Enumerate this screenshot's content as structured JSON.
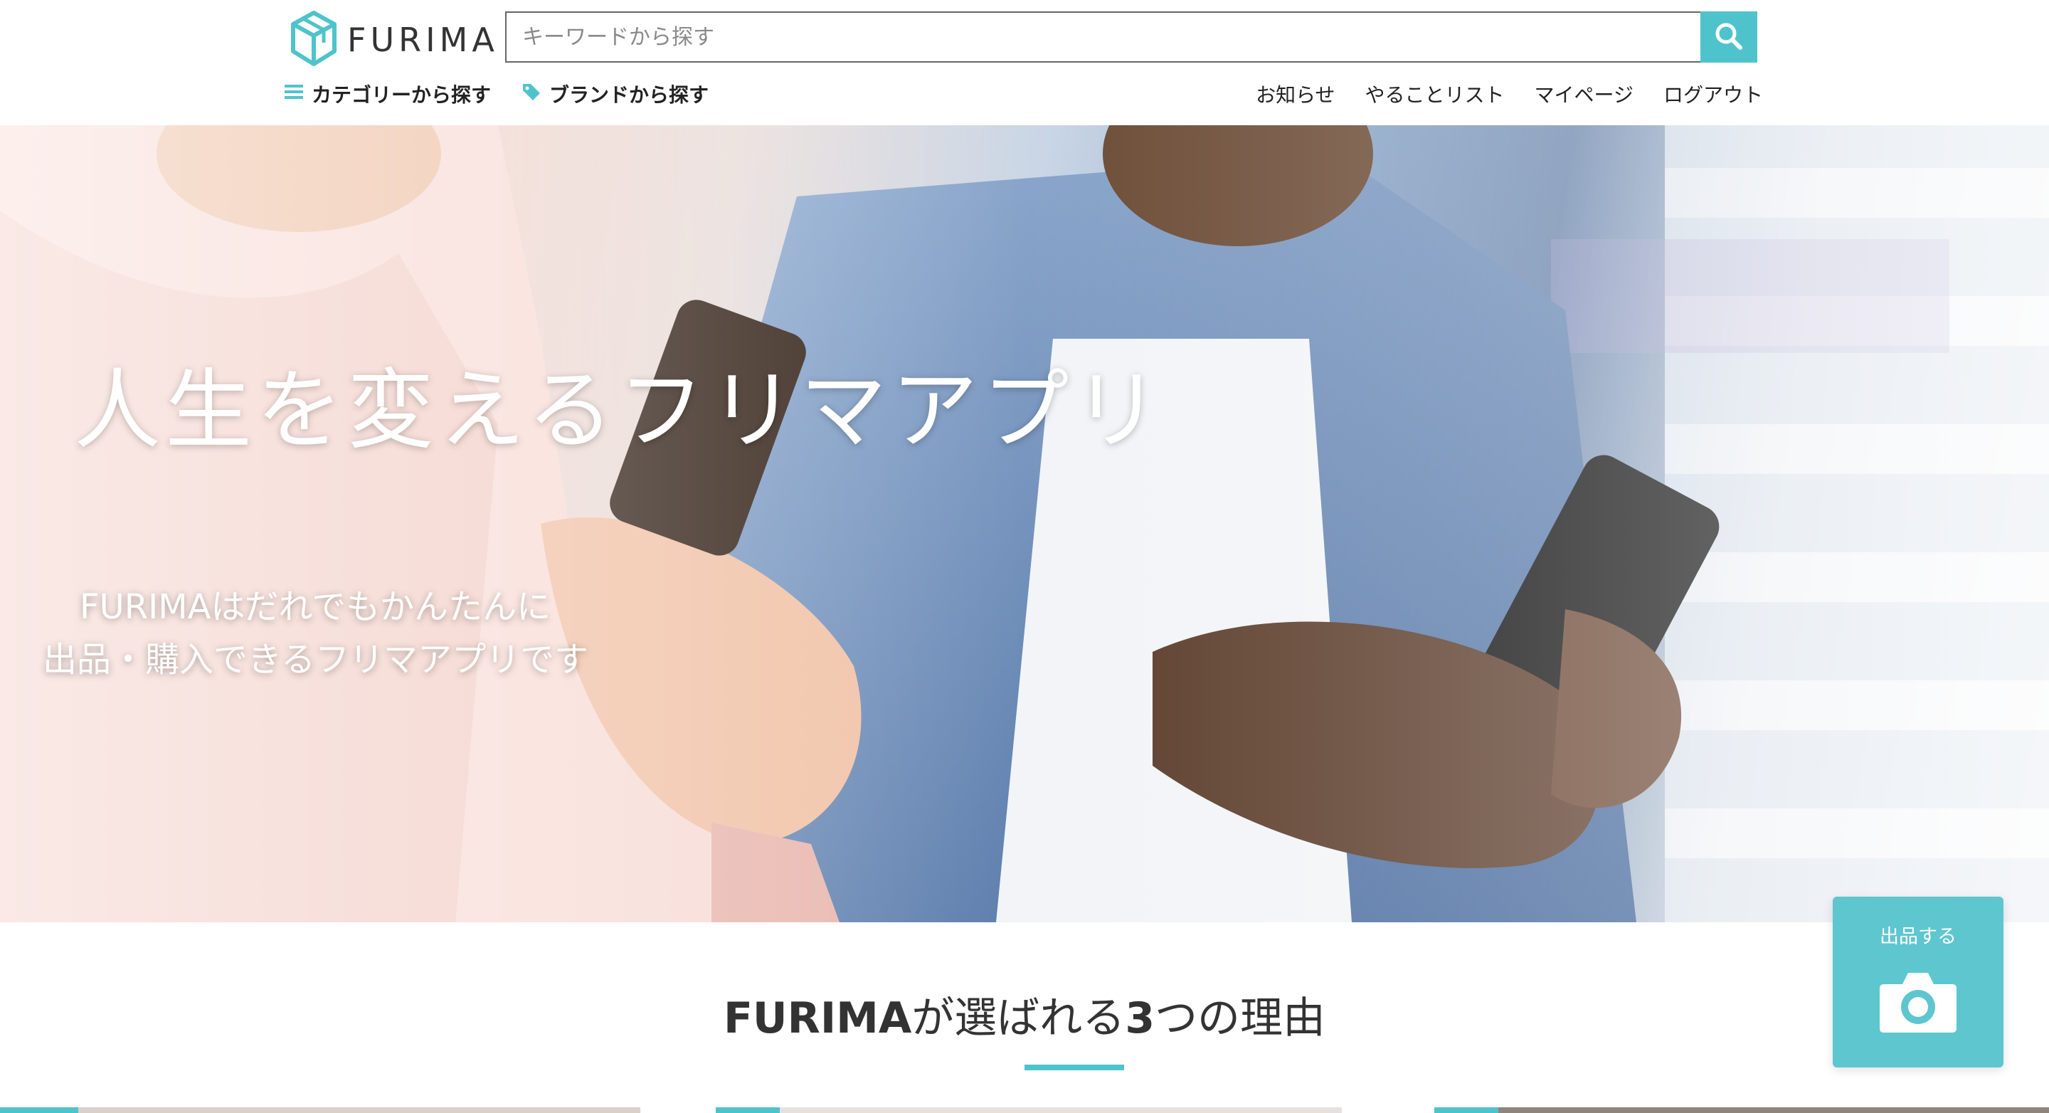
{
  "brand": {
    "name": "FURIMA",
    "accent_color": "#4fc3cc",
    "logo_icon": "cube-logo-icon"
  },
  "search": {
    "placeholder": "キーワードから探す",
    "value": "",
    "button_icon": "search-icon"
  },
  "subnav": {
    "left": [
      {
        "label": "カテゴリーから探す",
        "icon": "menu-icon"
      },
      {
        "label": "ブランドから探す",
        "icon": "tag-icon"
      }
    ],
    "right": [
      {
        "label": "お知らせ"
      },
      {
        "label": "やることリスト"
      },
      {
        "label": "マイページ"
      },
      {
        "label": "ログアウト"
      }
    ]
  },
  "hero": {
    "title": "人生を変えるフリマアプリ",
    "subtitle_line1": "FURIMAはだれでもかんたんに",
    "subtitle_line2": "出品・購入できるフリマアプリです"
  },
  "reasons": {
    "title_brand": "FURIMA",
    "title_mid": "が選ばれる",
    "title_num": "3",
    "title_rest": "つの理由"
  },
  "sell_button": {
    "label": "出品する",
    "icon": "camera-icon"
  }
}
